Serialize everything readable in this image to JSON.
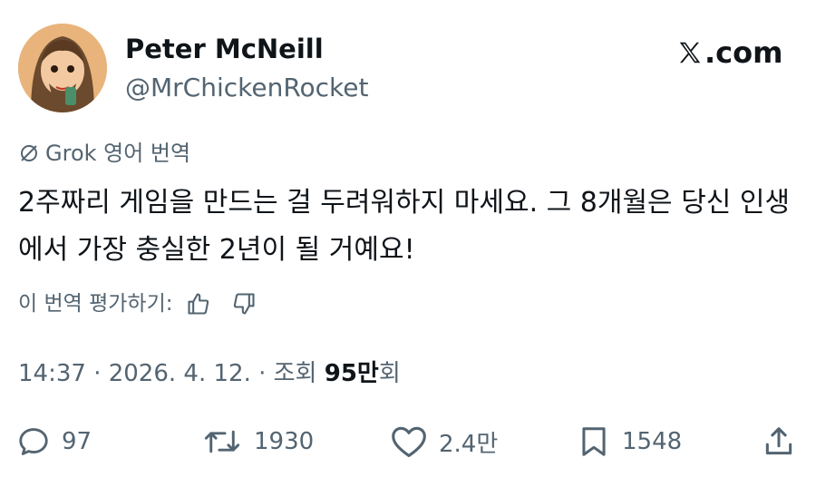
{
  "author": {
    "display_name": "Peter McNeill",
    "handle": "@MrChickenRocket"
  },
  "brand": {
    "label": ".com",
    "icon": "x-logo-icon"
  },
  "translation": {
    "label": "Grok 영어 번역",
    "icon": "grok-icon"
  },
  "tweet": {
    "text": "2주짜리 게임을 만드는 걸 두려워하지 마세요. 그 8개월은 당신 인생에서 가장 충실한 2년이 될 거예요!"
  },
  "rating": {
    "label": "이 번역 평가하기:",
    "icons": [
      "thumbs-up-icon",
      "thumbs-down-icon"
    ]
  },
  "meta": {
    "time_date": "14:37 · 2026. 4. 12. · 조회 ",
    "views_number": "95만",
    "views_suffix": "회"
  },
  "actions": {
    "replies": "97",
    "retweets": "1930",
    "likes": "2.4만",
    "bookmarks": "1548"
  },
  "colors": {
    "text": "#0f1419",
    "secondary": "#536471",
    "background": "#ffffff"
  }
}
